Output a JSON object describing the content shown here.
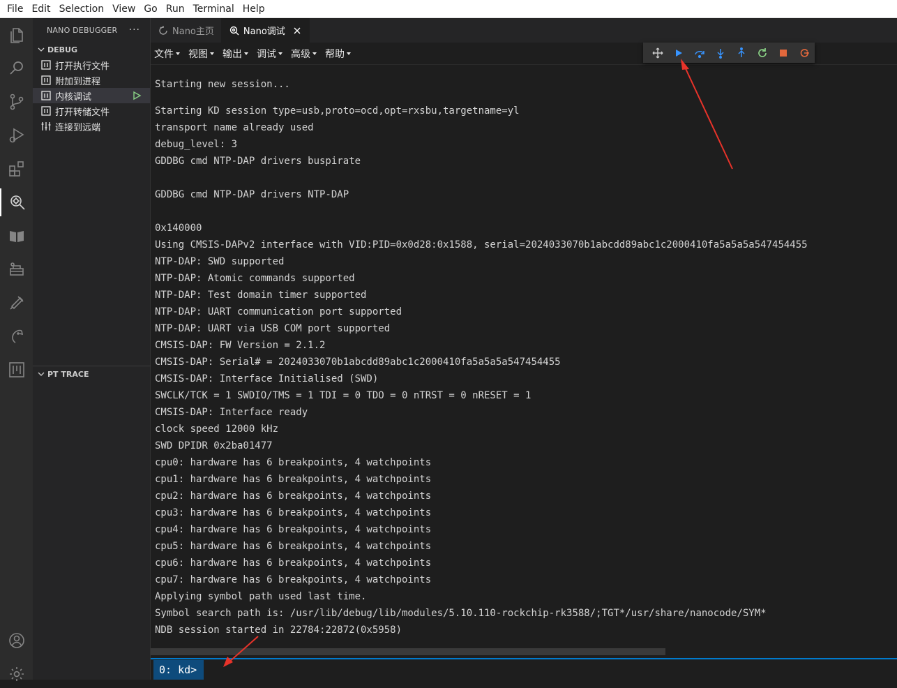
{
  "menubar": [
    "File",
    "Edit",
    "Selection",
    "View",
    "Go",
    "Run",
    "Terminal",
    "Help"
  ],
  "sidebar": {
    "title": "NANO DEBUGGER",
    "more": "···",
    "debug_section": "DEBUG",
    "items": [
      {
        "label": "打开执行文件"
      },
      {
        "label": "附加到进程"
      },
      {
        "label": "内核调试"
      },
      {
        "label": "打开转储文件"
      },
      {
        "label": "连接到远端"
      }
    ],
    "pt_section": "PT TRACE"
  },
  "tabs": [
    {
      "label": "Nano主页"
    },
    {
      "label": "Nano调试"
    }
  ],
  "editor_menu": [
    "文件",
    "视图",
    "输出",
    "调试",
    "高级",
    "帮助"
  ],
  "console_lines": [
    "Starting new session...",
    "",
    "Starting KD session type=usb,proto=ocd,opt=rxsbu,targetname=yl",
    "transport name already used",
    "debug_level: 3",
    "GDDBG cmd NTP-DAP drivers buspirate",
    "",
    "GDDBG cmd NTP-DAP drivers NTP-DAP",
    "",
    "0x140000",
    "Using CMSIS-DAPv2 interface with VID:PID=0x0d28:0x1588, serial=2024033070b1abcdd89abc1c2000410fa5a5a5a547454455",
    "NTP-DAP: SWD supported",
    "NTP-DAP: Atomic commands supported",
    "NTP-DAP: Test domain timer supported",
    "NTP-DAP: UART communication port supported",
    "NTP-DAP: UART via USB COM port supported",
    "CMSIS-DAP: FW Version = 2.1.2",
    "CMSIS-DAP: Serial# = 2024033070b1abcdd89abc1c2000410fa5a5a5a547454455",
    "CMSIS-DAP: Interface Initialised (SWD)",
    "SWCLK/TCK = 1 SWDIO/TMS = 1 TDI = 0 TDO = 0 nTRST = 0 nRESET = 1",
    "CMSIS-DAP: Interface ready",
    "clock speed 12000 kHz",
    "SWD DPIDR 0x2ba01477",
    "cpu0: hardware has 6 breakpoints, 4 watchpoints",
    "cpu1: hardware has 6 breakpoints, 4 watchpoints",
    "cpu2: hardware has 6 breakpoints, 4 watchpoints",
    "cpu3: hardware has 6 breakpoints, 4 watchpoints",
    "cpu4: hardware has 6 breakpoints, 4 watchpoints",
    "cpu5: hardware has 6 breakpoints, 4 watchpoints",
    "cpu6: hardware has 6 breakpoints, 4 watchpoints",
    "cpu7: hardware has 6 breakpoints, 4 watchpoints",
    "Applying symbol path used last time.",
    "Symbol search path is: /usr/lib/debug/lib/modules/5.10.110-rockchip-rk3588/;TGT*/usr/share/nanocode/SYM*",
    "NDB session started in 22784:22872(0x5958)"
  ],
  "prompt": "0: kd>",
  "colors": {
    "accent": "#007acc",
    "run": "#3794ff",
    "restart": "#89d185",
    "stop": "#f48771",
    "disconnect": "#e2683c",
    "arrow": "#e8332a"
  },
  "debug_toolbar": [
    "drag-handle-icon",
    "continue-icon",
    "step-over-icon",
    "step-into-icon",
    "step-out-icon",
    "restart-icon",
    "stop-icon",
    "disconnect-icon"
  ]
}
